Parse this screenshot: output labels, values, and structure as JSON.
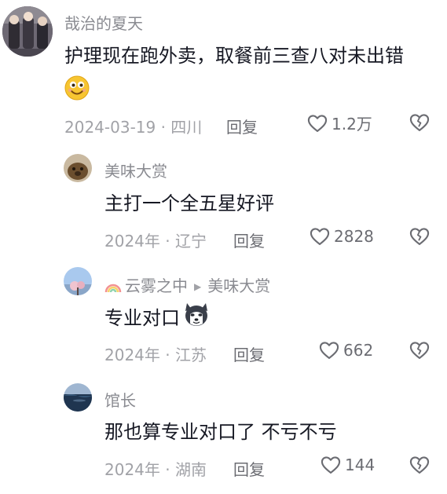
{
  "comments": [
    {
      "author": "哉治的夏天",
      "text": "护理现在跑外卖，取餐前三查八对未出错",
      "meta": "2024-03-19 · 四川",
      "reply_label": "回复",
      "likes": "1.2万"
    },
    {
      "author": "美味大赏",
      "text": "主打一个全五星好评",
      "meta": "2024年 · 辽宁",
      "reply_label": "回复",
      "likes": "2828"
    },
    {
      "author": "云雾之中",
      "reply_to": "美味大赏",
      "text": "专业对口",
      "meta": "2024年 · 江苏",
      "reply_label": "回复",
      "likes": "662"
    },
    {
      "author": "馆长",
      "text": "那也算专业对口了 不亏不亏",
      "meta": "2024年 · 湖南",
      "reply_label": "回复",
      "likes": "144"
    }
  ],
  "icons": {
    "like": "heart-outline-icon",
    "dislike": "broken-heart-icon",
    "emoji_smile": "smiling-face-emoji",
    "emoji_husky": "husky-emoji"
  }
}
